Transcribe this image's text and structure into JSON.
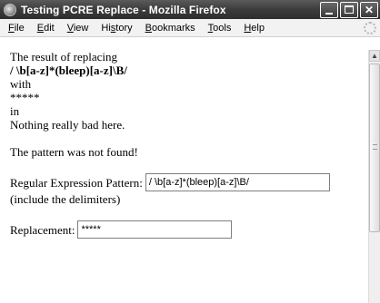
{
  "window": {
    "title": "Testing PCRE Replace - Mozilla Firefox",
    "app_icon": "firefox-icon",
    "buttons": {
      "minimize": "minimize-icon",
      "maximize": "maximize-icon",
      "close_label": "✕"
    }
  },
  "menubar": {
    "items": [
      {
        "first": "F",
        "rest": "ile"
      },
      {
        "first": "E",
        "rest": "dit"
      },
      {
        "first": "V",
        "rest": "iew"
      },
      {
        "first": "",
        "pre": "Hi",
        "under": "s",
        "post": "tory"
      },
      {
        "first": "B",
        "rest": "ookmarks"
      },
      {
        "first": "T",
        "rest": "ools"
      },
      {
        "first": "H",
        "rest": "elp"
      }
    ],
    "throbber": "loading-throbber-icon"
  },
  "content": {
    "line1": "The result of replacing",
    "pattern_display": "/ \\b[a-z]*(bleep)[a-z]\\B/",
    "with_label": "with",
    "replacement_display": "*****",
    "in_label": "in",
    "subject": "Nothing really bad here.",
    "result_message": "The pattern was not found!",
    "pattern_label": "Regular Expression Pattern:",
    "pattern_value": "/ \\b[a-z]*(bleep)[a-z]\\B/",
    "delimiters_note": "(include the delimiters)",
    "replacement_label": "Replacement:",
    "replacement_value": "*****"
  },
  "scrollbar": {
    "up": "▲"
  }
}
